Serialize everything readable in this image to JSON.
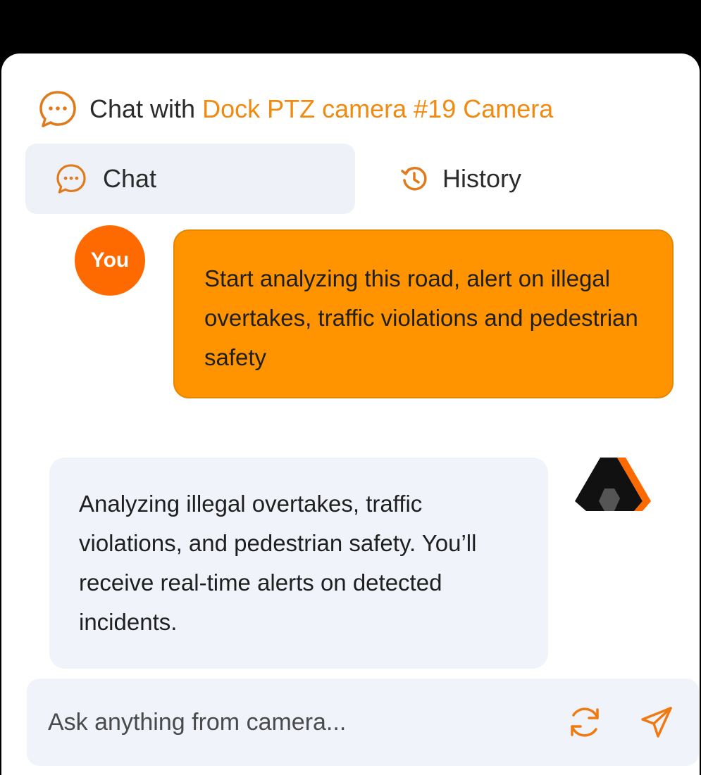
{
  "header": {
    "prefix": "Chat with",
    "camera_name": "Dock PTZ camera #19 Camera",
    "icon": "chat-bubble-icon"
  },
  "tabs": [
    {
      "label": "Chat",
      "icon": "chat-bubble-icon",
      "active": true
    },
    {
      "label": "History",
      "icon": "history-icon",
      "active": false
    }
  ],
  "messages": {
    "user": {
      "avatar_label": "You",
      "text": "Start analyzing this road, alert on illegal overtakes, traffic violations and pedestrian safety"
    },
    "bot": {
      "logo": "brand-logo-icon",
      "text": "Analyzing illegal overtakes, traffic violations, and pedestrian safety. You’ll receive real-time alerts on detected incidents."
    }
  },
  "input": {
    "placeholder": "Ask anything from camera...",
    "value": ""
  },
  "colors": {
    "accent": "#f08a10",
    "user_bubble": "#ff9400",
    "avatar": "#ff6a00",
    "bubble_bg": "#f0f3fa"
  }
}
